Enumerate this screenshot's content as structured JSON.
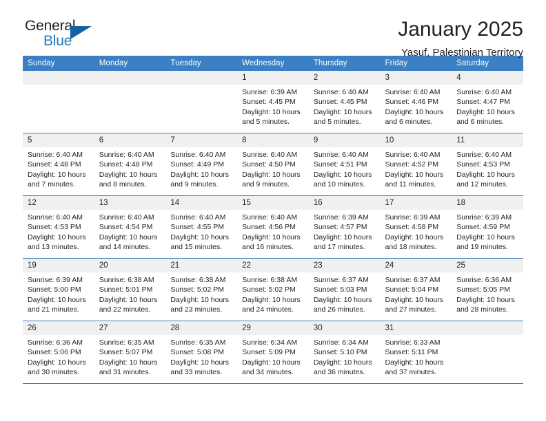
{
  "brand": {
    "word1": "General",
    "word2": "Blue",
    "triangle_color": "#1163a8",
    "blue_text_color": "#1f7ac0",
    "logo_icon": "triangle-icon"
  },
  "header": {
    "title": "January 2025",
    "location": "Yasuf, Palestinian Territory"
  },
  "theme": {
    "header_blue": "#3b7fc4",
    "daynum_band": "#f0f0f0",
    "text": "#231f20"
  },
  "calendar": {
    "weekday_headers": [
      "Sunday",
      "Monday",
      "Tuesday",
      "Wednesday",
      "Thursday",
      "Friday",
      "Saturday"
    ],
    "weeks": [
      [
        {
          "day": "",
          "sunrise": "",
          "sunset": "",
          "daylight_line1": "",
          "daylight_line2": "",
          "blank": true
        },
        {
          "day": "",
          "sunrise": "",
          "sunset": "",
          "daylight_line1": "",
          "daylight_line2": "",
          "blank": true
        },
        {
          "day": "",
          "sunrise": "",
          "sunset": "",
          "daylight_line1": "",
          "daylight_line2": "",
          "blank": true
        },
        {
          "day": "1",
          "sunrise": "Sunrise: 6:39 AM",
          "sunset": "Sunset: 4:45 PM",
          "daylight_line1": "Daylight: 10 hours",
          "daylight_line2": "and 5 minutes."
        },
        {
          "day": "2",
          "sunrise": "Sunrise: 6:40 AM",
          "sunset": "Sunset: 4:45 PM",
          "daylight_line1": "Daylight: 10 hours",
          "daylight_line2": "and 5 minutes."
        },
        {
          "day": "3",
          "sunrise": "Sunrise: 6:40 AM",
          "sunset": "Sunset: 4:46 PM",
          "daylight_line1": "Daylight: 10 hours",
          "daylight_line2": "and 6 minutes."
        },
        {
          "day": "4",
          "sunrise": "Sunrise: 6:40 AM",
          "sunset": "Sunset: 4:47 PM",
          "daylight_line1": "Daylight: 10 hours",
          "daylight_line2": "and 6 minutes."
        }
      ],
      [
        {
          "day": "5",
          "sunrise": "Sunrise: 6:40 AM",
          "sunset": "Sunset: 4:48 PM",
          "daylight_line1": "Daylight: 10 hours",
          "daylight_line2": "and 7 minutes."
        },
        {
          "day": "6",
          "sunrise": "Sunrise: 6:40 AM",
          "sunset": "Sunset: 4:48 PM",
          "daylight_line1": "Daylight: 10 hours",
          "daylight_line2": "and 8 minutes."
        },
        {
          "day": "7",
          "sunrise": "Sunrise: 6:40 AM",
          "sunset": "Sunset: 4:49 PM",
          "daylight_line1": "Daylight: 10 hours",
          "daylight_line2": "and 9 minutes."
        },
        {
          "day": "8",
          "sunrise": "Sunrise: 6:40 AM",
          "sunset": "Sunset: 4:50 PM",
          "daylight_line1": "Daylight: 10 hours",
          "daylight_line2": "and 9 minutes."
        },
        {
          "day": "9",
          "sunrise": "Sunrise: 6:40 AM",
          "sunset": "Sunset: 4:51 PM",
          "daylight_line1": "Daylight: 10 hours",
          "daylight_line2": "and 10 minutes."
        },
        {
          "day": "10",
          "sunrise": "Sunrise: 6:40 AM",
          "sunset": "Sunset: 4:52 PM",
          "daylight_line1": "Daylight: 10 hours",
          "daylight_line2": "and 11 minutes."
        },
        {
          "day": "11",
          "sunrise": "Sunrise: 6:40 AM",
          "sunset": "Sunset: 4:53 PM",
          "daylight_line1": "Daylight: 10 hours",
          "daylight_line2": "and 12 minutes."
        }
      ],
      [
        {
          "day": "12",
          "sunrise": "Sunrise: 6:40 AM",
          "sunset": "Sunset: 4:53 PM",
          "daylight_line1": "Daylight: 10 hours",
          "daylight_line2": "and 13 minutes."
        },
        {
          "day": "13",
          "sunrise": "Sunrise: 6:40 AM",
          "sunset": "Sunset: 4:54 PM",
          "daylight_line1": "Daylight: 10 hours",
          "daylight_line2": "and 14 minutes."
        },
        {
          "day": "14",
          "sunrise": "Sunrise: 6:40 AM",
          "sunset": "Sunset: 4:55 PM",
          "daylight_line1": "Daylight: 10 hours",
          "daylight_line2": "and 15 minutes."
        },
        {
          "day": "15",
          "sunrise": "Sunrise: 6:40 AM",
          "sunset": "Sunset: 4:56 PM",
          "daylight_line1": "Daylight: 10 hours",
          "daylight_line2": "and 16 minutes."
        },
        {
          "day": "16",
          "sunrise": "Sunrise: 6:39 AM",
          "sunset": "Sunset: 4:57 PM",
          "daylight_line1": "Daylight: 10 hours",
          "daylight_line2": "and 17 minutes."
        },
        {
          "day": "17",
          "sunrise": "Sunrise: 6:39 AM",
          "sunset": "Sunset: 4:58 PM",
          "daylight_line1": "Daylight: 10 hours",
          "daylight_line2": "and 18 minutes."
        },
        {
          "day": "18",
          "sunrise": "Sunrise: 6:39 AM",
          "sunset": "Sunset: 4:59 PM",
          "daylight_line1": "Daylight: 10 hours",
          "daylight_line2": "and 19 minutes."
        }
      ],
      [
        {
          "day": "19",
          "sunrise": "Sunrise: 6:39 AM",
          "sunset": "Sunset: 5:00 PM",
          "daylight_line1": "Daylight: 10 hours",
          "daylight_line2": "and 21 minutes."
        },
        {
          "day": "20",
          "sunrise": "Sunrise: 6:38 AM",
          "sunset": "Sunset: 5:01 PM",
          "daylight_line1": "Daylight: 10 hours",
          "daylight_line2": "and 22 minutes."
        },
        {
          "day": "21",
          "sunrise": "Sunrise: 6:38 AM",
          "sunset": "Sunset: 5:02 PM",
          "daylight_line1": "Daylight: 10 hours",
          "daylight_line2": "and 23 minutes."
        },
        {
          "day": "22",
          "sunrise": "Sunrise: 6:38 AM",
          "sunset": "Sunset: 5:02 PM",
          "daylight_line1": "Daylight: 10 hours",
          "daylight_line2": "and 24 minutes."
        },
        {
          "day": "23",
          "sunrise": "Sunrise: 6:37 AM",
          "sunset": "Sunset: 5:03 PM",
          "daylight_line1": "Daylight: 10 hours",
          "daylight_line2": "and 26 minutes."
        },
        {
          "day": "24",
          "sunrise": "Sunrise: 6:37 AM",
          "sunset": "Sunset: 5:04 PM",
          "daylight_line1": "Daylight: 10 hours",
          "daylight_line2": "and 27 minutes."
        },
        {
          "day": "25",
          "sunrise": "Sunrise: 6:36 AM",
          "sunset": "Sunset: 5:05 PM",
          "daylight_line1": "Daylight: 10 hours",
          "daylight_line2": "and 28 minutes."
        }
      ],
      [
        {
          "day": "26",
          "sunrise": "Sunrise: 6:36 AM",
          "sunset": "Sunset: 5:06 PM",
          "daylight_line1": "Daylight: 10 hours",
          "daylight_line2": "and 30 minutes."
        },
        {
          "day": "27",
          "sunrise": "Sunrise: 6:35 AM",
          "sunset": "Sunset: 5:07 PM",
          "daylight_line1": "Daylight: 10 hours",
          "daylight_line2": "and 31 minutes."
        },
        {
          "day": "28",
          "sunrise": "Sunrise: 6:35 AM",
          "sunset": "Sunset: 5:08 PM",
          "daylight_line1": "Daylight: 10 hours",
          "daylight_line2": "and 33 minutes."
        },
        {
          "day": "29",
          "sunrise": "Sunrise: 6:34 AM",
          "sunset": "Sunset: 5:09 PM",
          "daylight_line1": "Daylight: 10 hours",
          "daylight_line2": "and 34 minutes."
        },
        {
          "day": "30",
          "sunrise": "Sunrise: 6:34 AM",
          "sunset": "Sunset: 5:10 PM",
          "daylight_line1": "Daylight: 10 hours",
          "daylight_line2": "and 36 minutes."
        },
        {
          "day": "31",
          "sunrise": "Sunrise: 6:33 AM",
          "sunset": "Sunset: 5:11 PM",
          "daylight_line1": "Daylight: 10 hours",
          "daylight_line2": "and 37 minutes."
        },
        {
          "day": "",
          "sunrise": "",
          "sunset": "",
          "daylight_line1": "",
          "daylight_line2": "",
          "blank": true
        }
      ]
    ]
  }
}
